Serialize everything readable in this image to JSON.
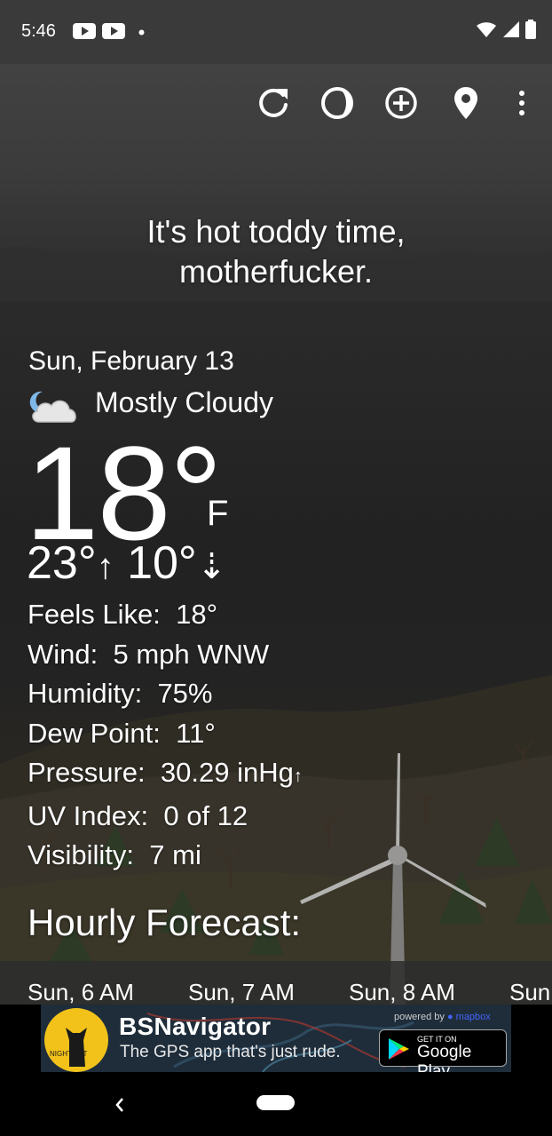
{
  "status_bar": {
    "time": "5:46"
  },
  "toolbar": {
    "refresh_icon": "refresh-icon",
    "theme_icon": "moon-phase-icon",
    "add_icon": "add-location-icon",
    "location_icon": "map-pin-icon",
    "menu_icon": "more-vert-icon"
  },
  "tagline": {
    "line1": "It's hot toddy time,",
    "line2": "motherfucker."
  },
  "current": {
    "date": "Sun, February 13",
    "condition": "Mostly Cloudy",
    "condition_icon": "partly-cloudy-night-icon",
    "temperature": "18°",
    "unit": "F",
    "high": "23°",
    "low": "10°"
  },
  "details": {
    "feels_like_label": "Feels Like:",
    "feels_like": "18°",
    "wind_label": "Wind:",
    "wind": "5 mph WNW",
    "humidity_label": "Humidity:",
    "humidity": "75%",
    "dew_point_label": "Dew Point:",
    "dew_point": "11°",
    "pressure_label": "Pressure:",
    "pressure": "30.29 inHg",
    "uv_label": "UV Index:",
    "uv": "0 of 12",
    "visibility_label": "Visibility:",
    "visibility": "7 mi"
  },
  "hourly": {
    "title": "Hourly Forecast:",
    "items": [
      "Sun, 6 AM",
      "Sun, 7 AM",
      "Sun, 8 AM",
      "Sun,"
    ]
  },
  "ad": {
    "brand": "NIGHT CAT",
    "title": "BSNavigator",
    "subtitle": "The GPS app that's just rude.",
    "powered_by": "powered by",
    "powered_brand": "mapbox",
    "store_small": "GET IT ON",
    "store_big": "Google Play"
  },
  "colors": {
    "ad_yellow": "#f2c21a",
    "ad_bg": "#1f2d3b",
    "mapbox_blue": "#4264fb"
  }
}
